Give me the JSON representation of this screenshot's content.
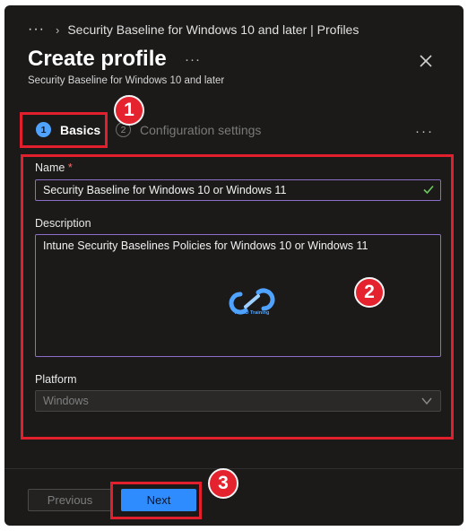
{
  "breadcrumb": {
    "more": "···",
    "chevron": "›",
    "text": "Security Baseline for Windows 10 and later | Profiles"
  },
  "header": {
    "title": "Create profile",
    "more": "···",
    "subtitle": "Security Baseline for Windows 10 and later"
  },
  "tabs": [
    {
      "number": "1",
      "label": "Basics",
      "active": true
    },
    {
      "number": "2",
      "label": "Configuration settings",
      "active": false
    }
  ],
  "tabs_more": "···",
  "form": {
    "name": {
      "label": "Name",
      "required": "*",
      "value": "Security Baseline for Windows 10 or Windows 11"
    },
    "description": {
      "label": "Description",
      "value": "Intune Security Baselines Policies for Windows 10 or Windows 11"
    },
    "platform": {
      "label": "Platform",
      "value": "Windows"
    }
  },
  "watermark": {
    "text": "HTMD Training"
  },
  "footer": {
    "previous_label": "Previous",
    "next_label": "Next"
  },
  "annotations": [
    {
      "number": "1"
    },
    {
      "number": "2"
    },
    {
      "number": "3"
    }
  ],
  "colors": {
    "panel_background": "#1b1a19",
    "accent_blue": "#2f8cff",
    "annotation_red": "#e21f2c",
    "input_border": "#8b6fc9",
    "valid_check": "#6ccb5f"
  },
  "icons": {
    "close": "close-icon",
    "valid": "checkmark-icon",
    "dropdown": "chevron-down-icon"
  }
}
